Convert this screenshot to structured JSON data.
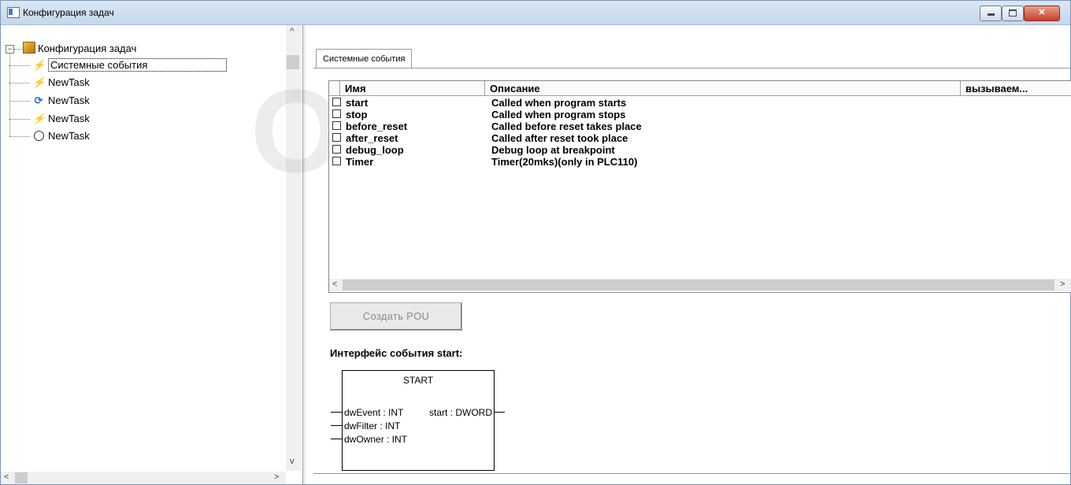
{
  "window": {
    "title": "Конфигурация задач",
    "min_glyph": "",
    "max_glyph": "",
    "close_glyph": "✕"
  },
  "tree": {
    "root_label": "Конфигурация задач",
    "expander": "⊟",
    "items": [
      {
        "label": "Системные события",
        "icon": "lightning-icon",
        "glyph": "⚡"
      },
      {
        "label": "NewTask",
        "icon": "lightning-icon",
        "glyph": "⚡"
      },
      {
        "label": "NewTask",
        "icon": "cyclic-icon",
        "glyph": "⟳"
      },
      {
        "label": "NewTask",
        "icon": "lightning-icon",
        "glyph": "⚡"
      },
      {
        "label": "NewTask",
        "icon": "clock-icon",
        "glyph": ""
      }
    ],
    "scroll_up": "^",
    "scroll_down": "v",
    "scroll_left": "<",
    "scroll_right": ">"
  },
  "tab": {
    "label": "Системные события"
  },
  "event_list": {
    "columns": [
      "Имя",
      "Описание",
      "вызываем..."
    ],
    "rows": [
      {
        "name": "start",
        "desc": "Called when program starts"
      },
      {
        "name": "stop",
        "desc": "Called when program stops"
      },
      {
        "name": "before_reset",
        "desc": "Called before reset takes place"
      },
      {
        "name": "after_reset",
        "desc": "Called after reset took place"
      },
      {
        "name": "debug_loop",
        "desc": "Debug loop at breakpoint"
      },
      {
        "name": "Timer",
        "desc": "Timer(20mks)(only in PLC110)"
      }
    ],
    "scroll_left": "<",
    "scroll_right": ">"
  },
  "create_pou_button": "Создать POU",
  "interface_label": "Интерфейс события start:",
  "function_block": {
    "name": "START",
    "inputs": [
      "dwEvent : INT",
      "dwFilter : INT",
      "dwOwner : INT"
    ],
    "output": "start : DWORD"
  },
  "watermark": "OLIDA"
}
